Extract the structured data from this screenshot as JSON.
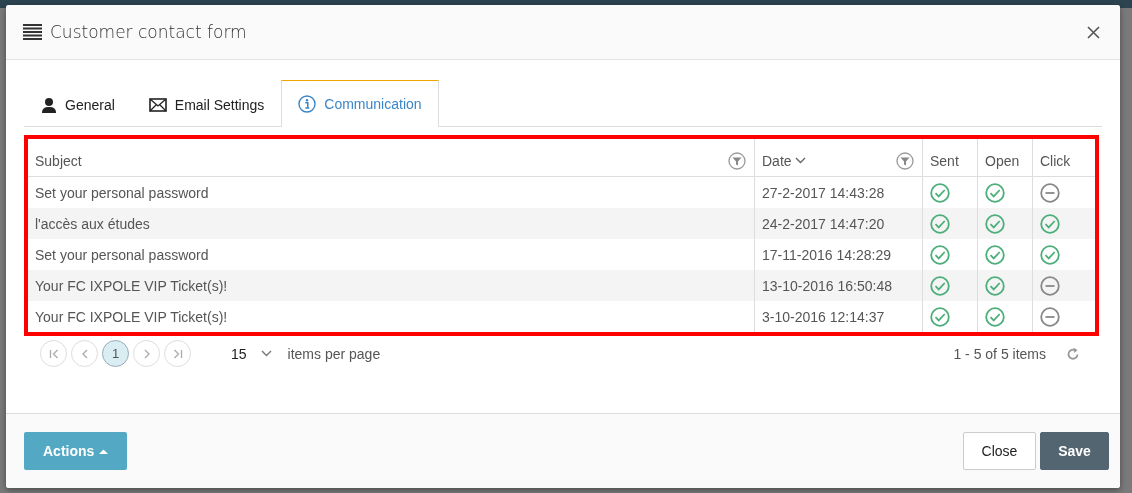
{
  "dialog": {
    "title": "Customer contact form"
  },
  "tabs": [
    {
      "label": "General",
      "selected": false
    },
    {
      "label": "Email Settings",
      "selected": false
    },
    {
      "label": "Communication",
      "selected": true
    }
  ],
  "table": {
    "highlighted": true,
    "columns": [
      {
        "label": "Subject",
        "filter": true,
        "sorted": false
      },
      {
        "label": "Date",
        "filter": true,
        "sorted": true
      },
      {
        "label": "Sent",
        "filter": false,
        "sorted": false
      },
      {
        "label": "Open",
        "filter": false,
        "sorted": false
      },
      {
        "label": "Click",
        "filter": false,
        "sorted": false
      }
    ],
    "rows": [
      {
        "subject": "Set your personal password",
        "date": "27-2-2017 14:43:28",
        "sent": true,
        "open": true,
        "click": false
      },
      {
        "subject": "l'accès aux études",
        "date": "24-2-2017 14:47:20",
        "sent": true,
        "open": true,
        "click": true
      },
      {
        "subject": "Set your personal password",
        "date": "17-11-2016 14:28:29",
        "sent": true,
        "open": true,
        "click": true
      },
      {
        "subject": "Your FC IXPOLE VIP Ticket(s)!",
        "date": "13-10-2016 16:50:48",
        "sent": true,
        "open": true,
        "click": false
      },
      {
        "subject": "Your FC IXPOLE VIP Ticket(s)!",
        "date": "3-10-2016 12:14:37",
        "sent": true,
        "open": true,
        "click": false
      }
    ]
  },
  "pager": {
    "pages": [
      {
        "label": "1",
        "selected": true
      }
    ],
    "page_size": "15",
    "page_size_label": "items per page",
    "summary": "1 - 5 of 5 items"
  },
  "footer": {
    "actions": "Actions",
    "buttons": [
      {
        "label": "Close",
        "kind": "default"
      },
      {
        "label": "Save",
        "kind": "primary"
      }
    ]
  }
}
